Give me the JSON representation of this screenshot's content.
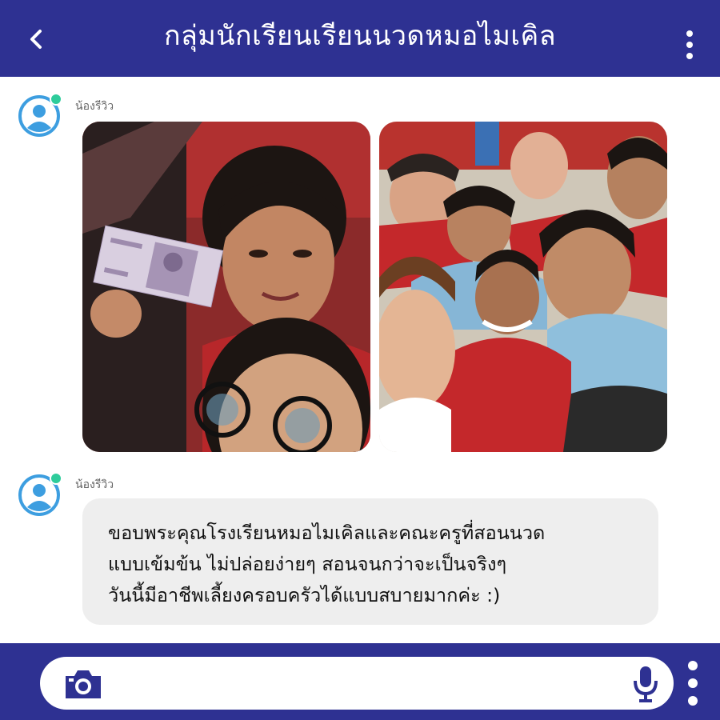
{
  "header": {
    "title": "กลุ่มนักเรียนเรียนนวดหมอไมเคิล",
    "back_icon": "chevron-left-icon",
    "menu_icon": "more-vertical-icon"
  },
  "messages": [
    {
      "sender": "น้องรีวิว",
      "avatar_icon": "user-avatar-icon",
      "type": "photos",
      "photos": [
        "photo-selfie-banknote",
        "photo-group-selfie"
      ]
    },
    {
      "sender": "น้องรีวิว",
      "avatar_icon": "user-avatar-icon",
      "type": "text",
      "lines": [
        "ขอบพระคุณโรงเรียนหมอไมเคิลและคณะครูที่สอนนวด",
        "แบบเข้มข้น ไม่ปล่อยง่ายๆ สอนจนกว่าจะเป็นจริงๆ",
        "วันนี้มีอาชีพเลี้ยงครอบครัวได้แบบสบายมากค่ะ :)"
      ]
    }
  ],
  "composer": {
    "camera_icon": "camera-icon",
    "mic_icon": "microphone-icon",
    "menu_icon": "more-vertical-icon"
  },
  "colors": {
    "brand": "#2e3192",
    "avatar": "#3d9ee0",
    "online": "#2ecc9b",
    "bubble": "#eeeeee"
  }
}
